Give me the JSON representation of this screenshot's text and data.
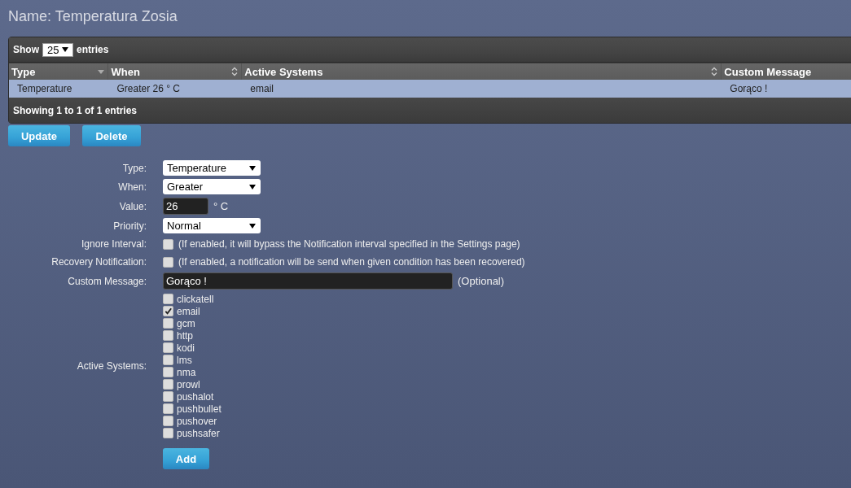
{
  "title": "Name: Temperatura Zosia",
  "table": {
    "length_label_before": "Show",
    "length_value": "25",
    "length_label_after": "entries",
    "columns": [
      {
        "label": "Type",
        "sorted": true
      },
      {
        "label": "When",
        "sorted": false
      },
      {
        "label": "Active Systems",
        "sorted": false
      },
      {
        "label": "Custom Message"
      }
    ],
    "rows": [
      {
        "selected": true,
        "cells": [
          "Temperature",
          "Greater 26 ° C",
          "email",
          "Gorąco !"
        ]
      }
    ],
    "info": "Showing 1 to 1 of 1 entries"
  },
  "buttons": [
    "Update",
    "Delete"
  ],
  "form": {
    "type": {
      "label": "Type:",
      "value": "Temperature"
    },
    "when": {
      "label": "When:",
      "value": "Greater"
    },
    "value": {
      "label": "Value:",
      "value": "26",
      "unit": "° C"
    },
    "priority": {
      "label": "Priority:",
      "value": "Normal"
    },
    "ignore_interval": {
      "label": "Ignore Interval:",
      "checked": false,
      "hint": "(If enabled, it will bypass the Notification interval specified in the Settings page)"
    },
    "recovery": {
      "label": "Recovery Notification:",
      "checked": false,
      "hint": "(If enabled, a notification will be send when given condition has been recovered)"
    },
    "custom_message": {
      "label": "Custom Message:",
      "value": "Gorąco !",
      "note": "(Optional)"
    },
    "active_systems": {
      "label": "Active Systems:",
      "items": [
        {
          "label": "clickatell",
          "checked": false
        },
        {
          "label": "email",
          "checked": true
        },
        {
          "label": "gcm",
          "checked": false
        },
        {
          "label": "http",
          "checked": false
        },
        {
          "label": "kodi",
          "checked": false
        },
        {
          "label": "lms",
          "checked": false
        },
        {
          "label": "nma",
          "checked": false
        },
        {
          "label": "prowl",
          "checked": false
        },
        {
          "label": "pushalot",
          "checked": false
        },
        {
          "label": "pushbullet",
          "checked": false
        },
        {
          "label": "pushover",
          "checked": false
        },
        {
          "label": "pushsafer",
          "checked": false
        }
      ]
    },
    "add_button": "Add"
  }
}
